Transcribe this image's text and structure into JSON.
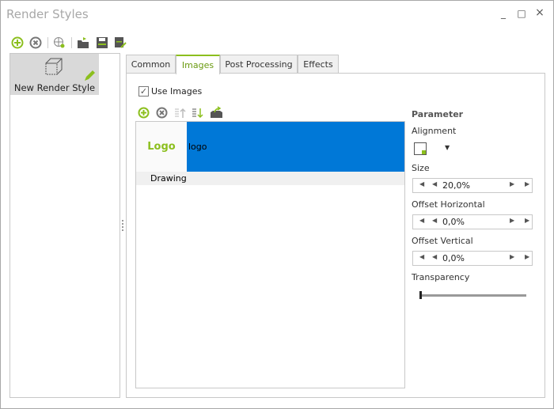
{
  "window": {
    "title": "Render Styles"
  },
  "toolbar": {
    "icons": [
      "add-icon",
      "delete-icon",
      "web-search-icon",
      "open-folder-icon",
      "save-icon",
      "save-as-icon"
    ]
  },
  "styles_list": {
    "items": [
      {
        "label": "New Render Style",
        "selected": true
      }
    ]
  },
  "tabs": [
    {
      "label": "Common"
    },
    {
      "label": "Images",
      "active": true
    },
    {
      "label": "Post Processing"
    },
    {
      "label": "Effects"
    }
  ],
  "images": {
    "use_images_label": "Use Images",
    "use_images_checked": true,
    "list": [
      {
        "thumb_text": "Logo",
        "name": "logo",
        "selected": true
      },
      {
        "name": "Drawing",
        "group": true
      }
    ]
  },
  "parameter": {
    "heading": "Parameter",
    "alignment_label": "Alignment",
    "size_label": "Size",
    "size_value": "20,0%",
    "offset_h_label": "Offset Horizontal",
    "offset_h_value": "0,0%",
    "offset_v_label": "Offset Vertical",
    "offset_v_value": "0,0%",
    "transparency_label": "Transparency",
    "transparency_value": 0
  },
  "colors": {
    "accent": "#8cbf1e",
    "selection": "#0078d7"
  }
}
